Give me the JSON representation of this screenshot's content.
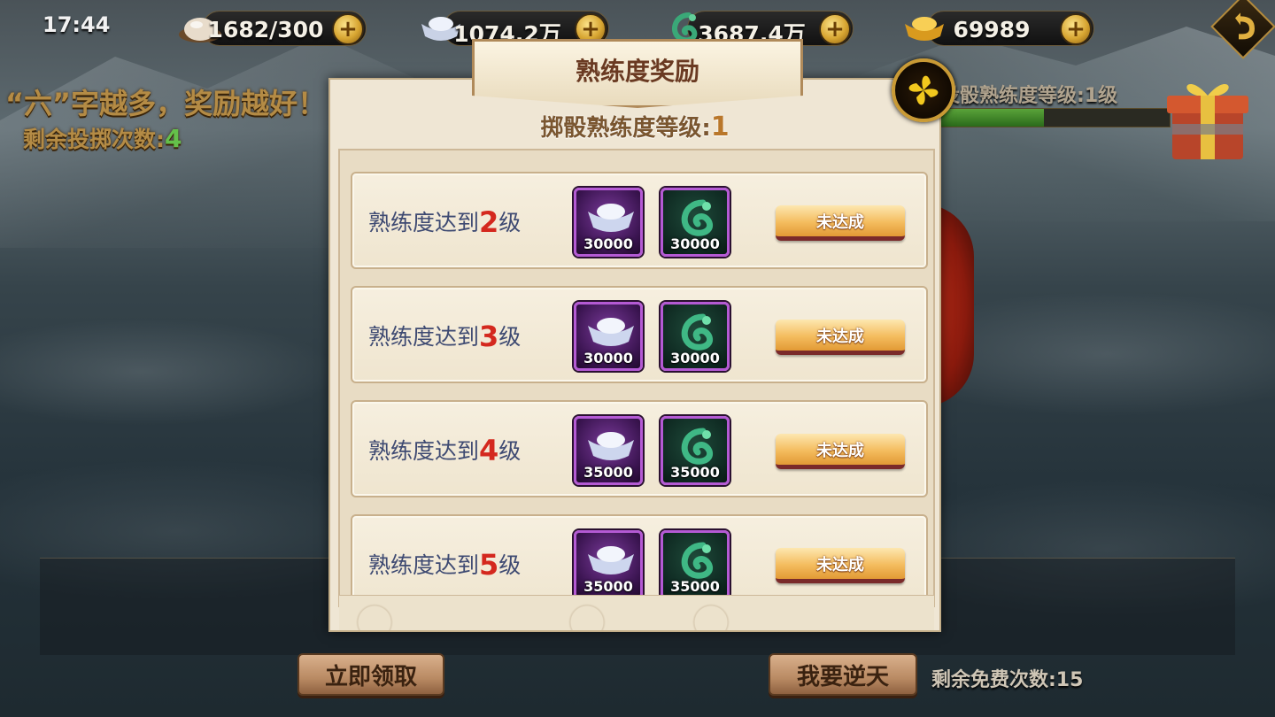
{
  "clock": "17:44",
  "resources": [
    {
      "name": "stamina",
      "icon": "bun-icon",
      "value": "1682/300"
    },
    {
      "name": "silver",
      "icon": "silver-ingot-icon",
      "value": "1074.2万"
    },
    {
      "name": "jade",
      "icon": "jade-dragon-icon",
      "value": "3687.4万"
    },
    {
      "name": "gold",
      "icon": "gold-ingot-icon",
      "value": "69989"
    }
  ],
  "slogan": "“六”字越多，奖励越好！",
  "remain_throws": {
    "label": "剩余投掷次数:",
    "value": "4"
  },
  "prof_right": {
    "label": "投骰熟练度等级:",
    "value": "1级"
  },
  "prof_progress": 0.45,
  "dialog": {
    "title": "熟练度奖励",
    "level_label": "掷骰熟练度等级:",
    "level_value": "1",
    "rows": [
      {
        "prefix": "熟练度达到",
        "level": "2",
        "suffix": "级",
        "silver": "30000",
        "jade": "30000",
        "status": "未达成"
      },
      {
        "prefix": "熟练度达到",
        "level": "3",
        "suffix": "级",
        "silver": "30000",
        "jade": "30000",
        "status": "未达成"
      },
      {
        "prefix": "熟练度达到",
        "level": "4",
        "suffix": "级",
        "silver": "35000",
        "jade": "35000",
        "status": "未达成"
      },
      {
        "prefix": "熟练度达到",
        "level": "5",
        "suffix": "级",
        "silver": "35000",
        "jade": "35000",
        "status": "未达成"
      }
    ]
  },
  "buttons": {
    "claim": "立即领取",
    "defy": "我要逆天"
  },
  "free_count": "剩余免费次数:15",
  "colors": {
    "accent_gold": "#c99a35",
    "level_red": "#d4281e",
    "label_blue": "#3e4a72",
    "remain_green": "#64c04a"
  }
}
